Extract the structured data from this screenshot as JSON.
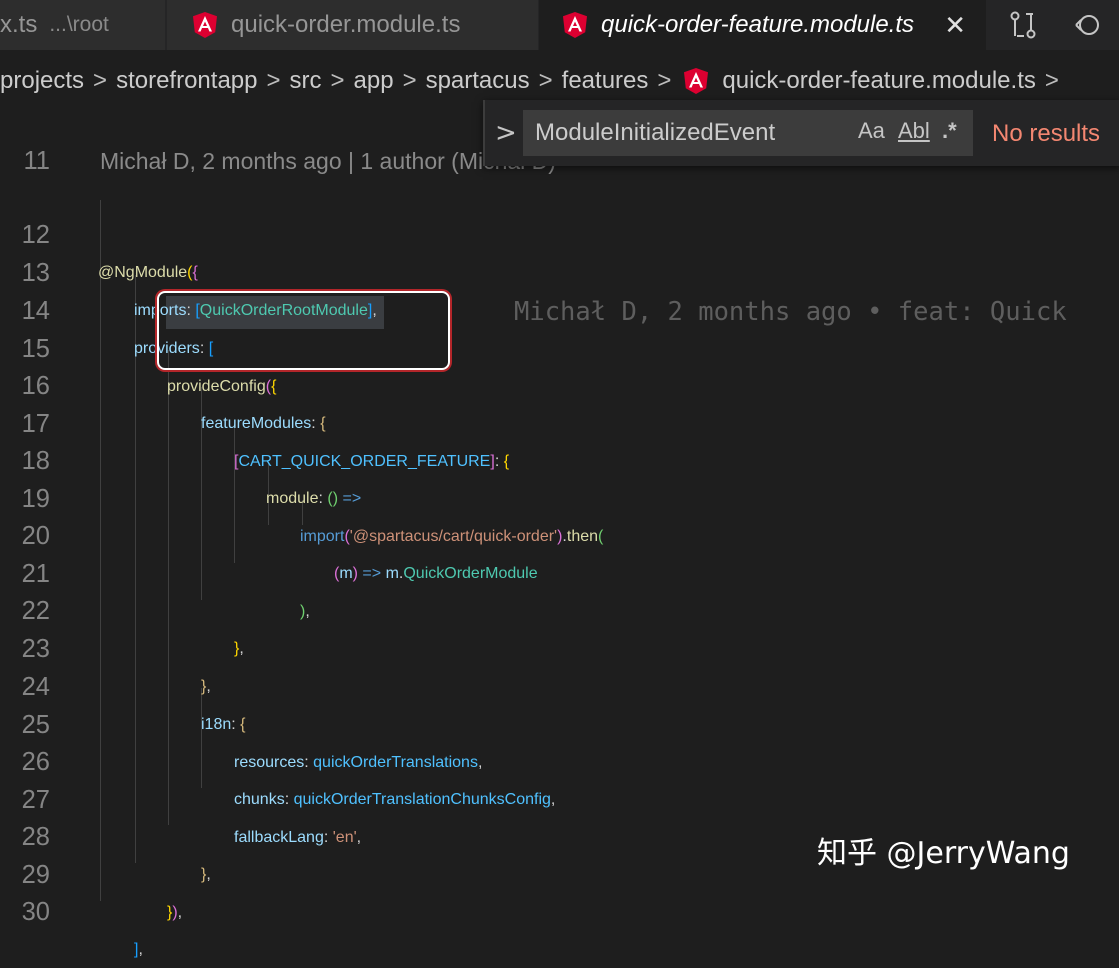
{
  "tabs": [
    {
      "label": "x.ts",
      "path": "...\\root"
    },
    {
      "label": "quick-order.module.ts"
    },
    {
      "label": "quick-order-feature.module.ts",
      "close": "✕"
    }
  ],
  "breadcrumb": [
    "projects",
    "storefrontapp",
    "src",
    "app",
    "spartacus",
    "features",
    "quick-order-feature.module.ts"
  ],
  "find": {
    "query": "ModuleInitializedEvent",
    "match_case": "Aa",
    "whole_word": "Abl",
    "regex": ".*",
    "status": "No results"
  },
  "blame": {
    "inline": "Michał D, 2 months ago | 1 author (Michał D)",
    "line15": "Michał D, 2 months ago • feat: Quick"
  },
  "line_numbers": [
    "11",
    "12",
    "13",
    "14",
    "15",
    "16",
    "17",
    "18",
    "19",
    "20",
    "21",
    "22",
    "23",
    "24",
    "25",
    "26",
    "27",
    "28",
    "29",
    "30"
  ],
  "code": {
    "l12": [
      "@NgModule",
      "(",
      "{"
    ],
    "l13": [
      "imports",
      ": ",
      "[",
      "QuickOrderRootModule",
      "]",
      ","
    ],
    "l14": [
      "providers",
      ": ",
      "["
    ],
    "l15": [
      "provideConfig",
      "(",
      "{"
    ],
    "l16": [
      "featureModules",
      ": ",
      "{"
    ],
    "l17": [
      "[",
      "CART_QUICK_ORDER_FEATURE",
      "]",
      ": ",
      "{"
    ],
    "l18": [
      "module",
      ": ",
      "()",
      " => "
    ],
    "l19": [
      "import",
      "(",
      "'@spartacus/cart/quick-order'",
      ")",
      ".",
      "then",
      "("
    ],
    "l20": [
      "(",
      "m",
      ")",
      " => ",
      "m",
      ".",
      "QuickOrderModule"
    ],
    "l21": [
      ")",
      ","
    ],
    "l22": [
      "}",
      ","
    ],
    "l23": [
      "}",
      ","
    ],
    "l24": [
      "i18n",
      ": ",
      "{"
    ],
    "l25": [
      "resources",
      ": ",
      "quickOrderTranslations",
      ","
    ],
    "l26": [
      "chunks",
      ": ",
      "quickOrderTranslationChunksConfig",
      ","
    ],
    "l27": [
      "fallbackLang",
      ": ",
      "'en'",
      ","
    ],
    "l28": [
      "}",
      ","
    ],
    "l29": [
      "}",
      ")",
      ","
    ],
    "l30": [
      "]",
      ","
    ]
  },
  "watermark": "知乎 @JerryWang",
  "colors": {
    "accent_error": "#f48771",
    "angular_red": "#dd0031",
    "highlight_border": "#b3262a"
  }
}
